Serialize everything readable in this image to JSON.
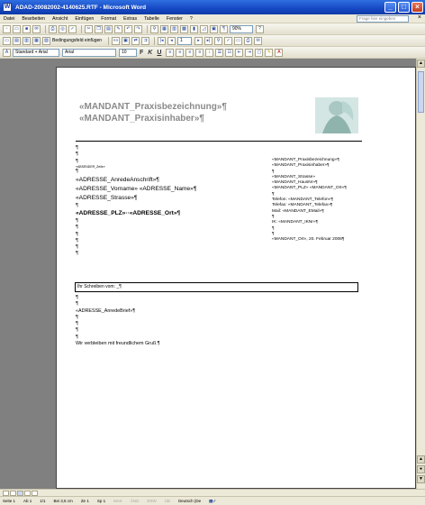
{
  "window": {
    "title": "ADAD-20082002-4140625.RTF - Microsoft Word",
    "app_icon": "word-icon"
  },
  "menu": {
    "items": [
      "Datei",
      "Bearbeiten",
      "Ansicht",
      "Einfügen",
      "Format",
      "Extras",
      "Tabelle",
      "Fenster",
      "?"
    ],
    "help_placeholder": "Frage hier eingeben"
  },
  "toolbar_format": {
    "mailmerge_label": "Bedingungsfeld einfügen",
    "style": "Standard + Arial",
    "font": "Arial",
    "size": "10",
    "zoom": "90%"
  },
  "letterhead": {
    "line1": "«MANDANT_Praxisbezeichnung»¶",
    "line2": "«MANDANT_Praxisinhaber»¶"
  },
  "left_block": {
    "p1": "¶",
    "p2": "¶",
    "p3": "¶",
    "sender_small": "«ABSENDER_Zeile»",
    "p4": "¶",
    "addr1": "«ADRESSE_AnredeAnschrift»¶",
    "addr2": "«ADRESSE_Vorname» «ADRESSE_Name»¶",
    "addr3": "«ADRESSE_Strasse»¶",
    "p5": "¶",
    "addr4": "«ADRESSE_PLZ»··«ADRESSE_Ort»¶",
    "p6": "¶",
    "p7": "¶",
    "p8": "¶",
    "p9": "¶",
    "p10": "¶",
    "p11": "¶"
  },
  "right_block": {
    "r1": "«MANDANT_Praxisbezeichnung»¶",
    "r2": "«MANDANT_Praxisinhaber»¶",
    "r3": "¶",
    "r4": "«MANDANT_Strasse»",
    "r5": "«MANDANT_HausNr»¶",
    "r6": "«MANDANT_PLZ» «MANDANT_Ort»¶",
    "r7": "¶",
    "r8": "Telefon: «MANDANT_Telefon»¶",
    "r9": "Telefax: «MANDANT_Telefax»¶",
    "r10": "Mail: «MANDANT_EMail»¶",
    "r11": "¶",
    "r12": "IK: «MANDANT_IKNr»¶",
    "r13": "¶",
    "r14": "¶",
    "r15": "«MANDANT_Ort», 20. Februar 2008¶"
  },
  "textbox": {
    "text": "Ihr Schreiben vom: _¶"
  },
  "lower_block": {
    "l1": "¶",
    "l2": "¶",
    "l3": "«ADRESSE_AnredeBrief»¶",
    "l4": "¶",
    "l5": "¶",
    "l6": "¶",
    "l7": "¶",
    "l8": "Wir verbleiben mit freundlichem Gruß.¶"
  },
  "status": {
    "page": "Seite 1",
    "section": "Ab 1",
    "pages": "1/1",
    "position": "Bei 3,5 cm",
    "line": "Ze 1",
    "column": "Sp 1",
    "mak": "MAK",
    "aend": "ÄND",
    "erw": "ERW",
    "ub": "ÜB",
    "language": "Deutsch (De",
    "spell_icon": "spellcheck-book-icon"
  }
}
